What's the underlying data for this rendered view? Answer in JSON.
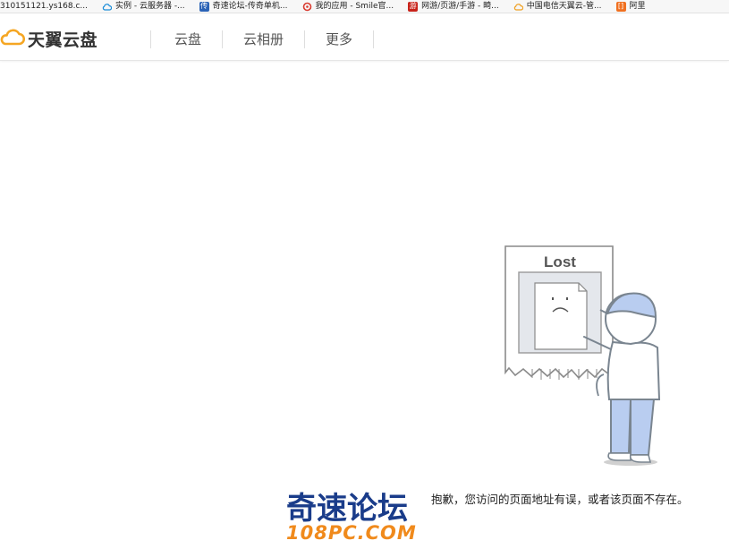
{
  "bookmarks": [
    {
      "text": "310151121.ys168.c...",
      "icon": "globe-icon",
      "color": "#6a9fd6"
    },
    {
      "text": "实例 - 云服务器 -...",
      "icon": "cloud-icon",
      "color": "#1a8cd8"
    },
    {
      "text": "奇速论坛-传奇单机...",
      "icon": "chuan-icon",
      "color": "#2b63b6"
    },
    {
      "text": "我的应用 - Smile官...",
      "icon": "refresh-icon",
      "color": "#d93a2f"
    },
    {
      "text": "网游/页游/手游 - 畸...",
      "icon": "bookmark-red-icon",
      "color": "#c8231a"
    },
    {
      "text": "中国电信天翼云-管...",
      "icon": "cloud-orange-icon",
      "color": "#f0a020"
    },
    {
      "text": "阿里",
      "icon": "aliyun-icon",
      "color": "#f07020"
    }
  ],
  "header": {
    "logo_text": "天翼云盘",
    "nav": [
      "云盘",
      "云相册",
      "更多"
    ]
  },
  "error": {
    "sign_text": "Lost",
    "message": "抱歉，您访问的页面地址有误，或者该页面不存在。"
  },
  "watermark": {
    "title": "奇速论坛",
    "subtitle": "108PC.COM"
  },
  "colors": {
    "logo_orange": "#f5a623",
    "watermark_blue": "#1a3c8a",
    "watermark_orange": "#f08a1c",
    "figure_blue": "#b9cdf0"
  }
}
